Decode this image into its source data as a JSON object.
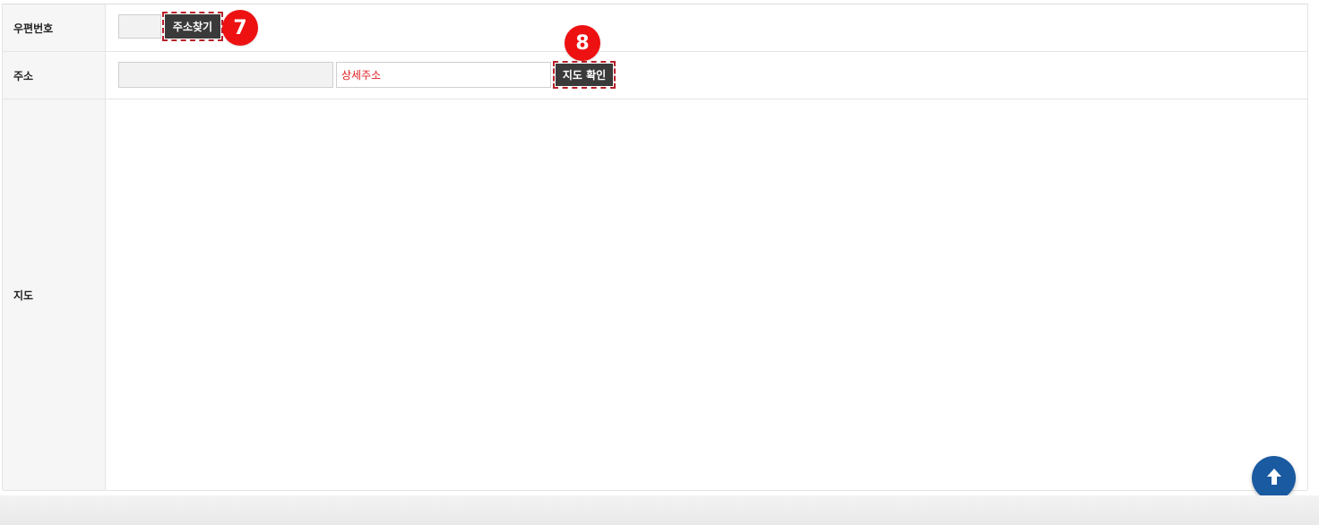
{
  "form": {
    "postcode": {
      "label": "우편번호",
      "value": "",
      "find_button": "주소찾기"
    },
    "address": {
      "label": "주소",
      "value": "",
      "detail_placeholder": "상세주소",
      "map_button": "지도 확인"
    },
    "map": {
      "label": "지도"
    }
  },
  "annotations": {
    "badge_7": "7",
    "badge_8": "8"
  },
  "icons": {
    "scroll_top": "arrow-up-icon"
  },
  "colors": {
    "badge": "#ee1111",
    "button": "#3a3a3a",
    "detail_text": "#e02020",
    "scroll_top": "#1a5aa0"
  }
}
